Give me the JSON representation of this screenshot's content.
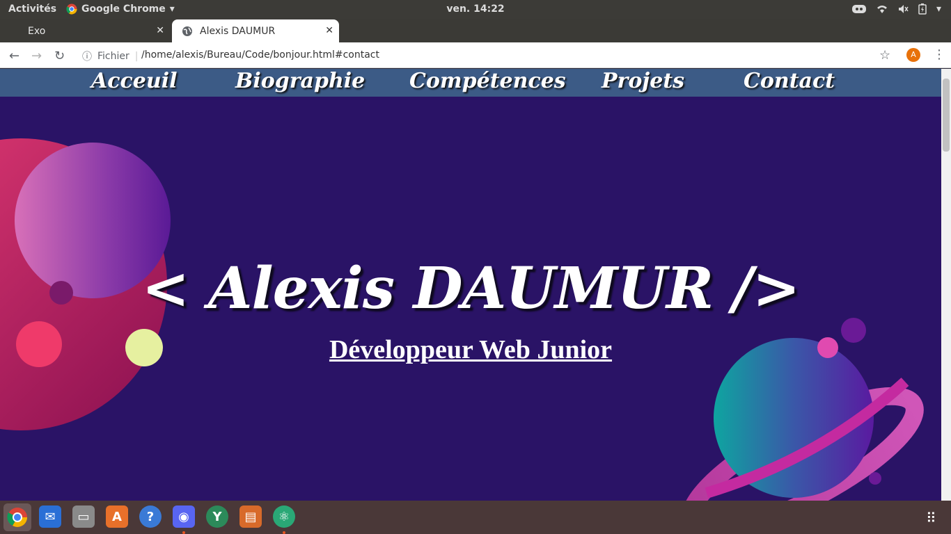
{
  "topbar": {
    "activities": "Activités",
    "app_name": "Google Chrome",
    "clock": "ven. 14:22"
  },
  "browser": {
    "tabs": [
      {
        "title": "Exo",
        "active": false
      },
      {
        "title": "Alexis DAUMUR",
        "active": true
      }
    ],
    "security_label": "Fichier",
    "url": "/home/alexis/Bureau/Code/bonjour.html#contact",
    "profile_initial": "A"
  },
  "page": {
    "nav": [
      "Acceuil",
      "Biographie",
      "Compétences",
      "Projets",
      "Contact"
    ],
    "title": "< Alexis DAUMUR />",
    "subtitle": "Développeur Web Junior"
  },
  "dock": {
    "apps": [
      "chrome-icon",
      "thunderbird-icon",
      "files-icon",
      "software-center-icon",
      "help-icon",
      "discord-icon",
      "yarn-icon",
      "impress-icon",
      "atom-icon"
    ]
  },
  "colors": {
    "page_bg": "#2a1366",
    "nav_bg": "#3c5b86",
    "accent_orange": "#e95420"
  }
}
